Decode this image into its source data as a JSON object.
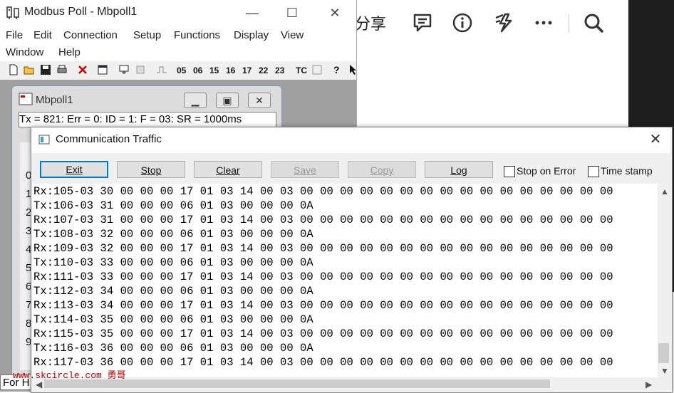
{
  "browser": {
    "share_label": "分享"
  },
  "app": {
    "title": "Modbus Poll - Mbpoll1",
    "menus": [
      "File",
      "Edit",
      "Connection",
      "Setup",
      "Functions",
      "Display",
      "View",
      "Window",
      "Help"
    ],
    "toolbar_codes": [
      "05",
      "06",
      "15",
      "16",
      "17",
      "22",
      "23",
      "TC"
    ]
  },
  "child": {
    "title": "Mbpoll1",
    "status": "Tx = 821: Err = 0: ID = 1: F = 03: SR = 1000ms",
    "row_numbers": [
      "0",
      "1",
      "2",
      "3",
      "4",
      "5",
      "6",
      "7",
      "8",
      "9"
    ],
    "bottom_text": "For H"
  },
  "dialog": {
    "title": "Communication Traffic",
    "buttons": {
      "exit": "Exit",
      "stop": "Stop",
      "clear": "Clear",
      "save": "Save",
      "copy": "Copy",
      "log": "Log"
    },
    "stop_on_error": "Stop on Error",
    "time_stamp": "Time stamp",
    "lines": [
      "Rx:105-03 30 00 00 00 17 01 03 14 00 03 00 00 00 00 00 00 00 00 00 00 00 00 00 00 00 00",
      "Tx:106-03 31 00 00 00 06 01 03 00 00 00 0A",
      "Rx:107-03 31 00 00 00 17 01 03 14 00 03 00 00 00 00 00 00 00 00 00 00 00 00 00 00 00 00",
      "Tx:108-03 32 00 00 00 06 01 03 00 00 00 0A",
      "Rx:109-03 32 00 00 00 17 01 03 14 00 03 00 00 00 00 00 00 00 00 00 00 00 00 00 00 00 00",
      "Tx:110-03 33 00 00 00 06 01 03 00 00 00 0A",
      "Rx:111-03 33 00 00 00 17 01 03 14 00 03 00 00 00 00 00 00 00 00 00 00 00 00 00 00 00 00",
      "Tx:112-03 34 00 00 00 06 01 03 00 00 00 0A",
      "Rx:113-03 34 00 00 00 17 01 03 14 00 03 00 00 00 00 00 00 00 00 00 00 00 00 00 00 00 00",
      "Tx:114-03 35 00 00 00 06 01 03 00 00 00 0A",
      "Rx:115-03 35 00 00 00 17 01 03 14 00 03 00 00 00 00 00 00 00 00 00 00 00 00 00 00 00 00",
      "Tx:116-03 36 00 00 00 06 01 03 00 00 00 0A",
      "Rx:117-03 36 00 00 00 17 01 03 14 00 03 00 00 00 00 00 00 00 00 00 00 00 00 00 00 00 00"
    ]
  },
  "watermark": "www.skcircle.com 勇哥"
}
